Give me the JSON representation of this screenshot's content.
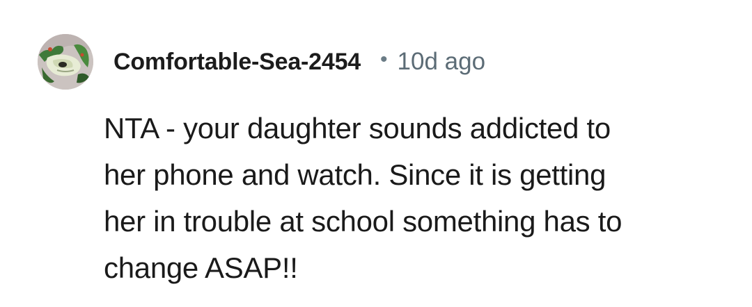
{
  "comment": {
    "author": "Comfortable-Sea-2454",
    "separator": "•",
    "timestamp": "10d ago",
    "body_lines": [
      "NTA - your daughter sounds addicted to",
      "her phone and watch. Since it is getting",
      "her in trouble at school something has to",
      "change ASAP!!"
    ]
  }
}
